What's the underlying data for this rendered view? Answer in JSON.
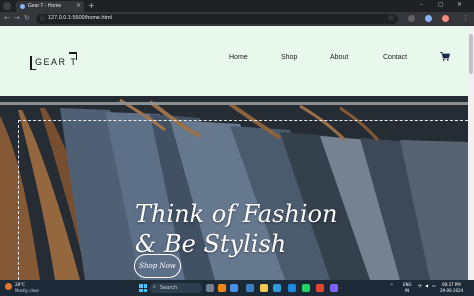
{
  "browser": {
    "tab_title": "Gear T - Home",
    "url": "127.0.0.1:5500/home.html",
    "new_tab_glyph": "+",
    "close_glyph": "×",
    "icons": [
      "back-icon",
      "forward-icon",
      "reload-icon",
      "info-icon",
      "star-icon",
      "extensions-icon",
      "profile-icon",
      "menu-icon"
    ]
  },
  "site": {
    "logo_text": "GEAR T",
    "nav": {
      "home": "Home",
      "shop": "Shop",
      "about": "About",
      "contact": "Contact"
    },
    "cart_icon": "cart-icon",
    "hero": {
      "line1": "Think of Fashion",
      "line2": "& Be Stylish",
      "cta": "Shop Now"
    },
    "colors": {
      "header_bg": "#e9f8ec",
      "hero_text": "#ffffff"
    }
  },
  "taskbar": {
    "weather_temp": "28°C",
    "weather_desc": "Mostly clear",
    "search_placeholder": "Search",
    "lang_top": "ENG",
    "lang_bottom": "IN",
    "time": "08:37 PM",
    "date": "29-06-2024"
  }
}
